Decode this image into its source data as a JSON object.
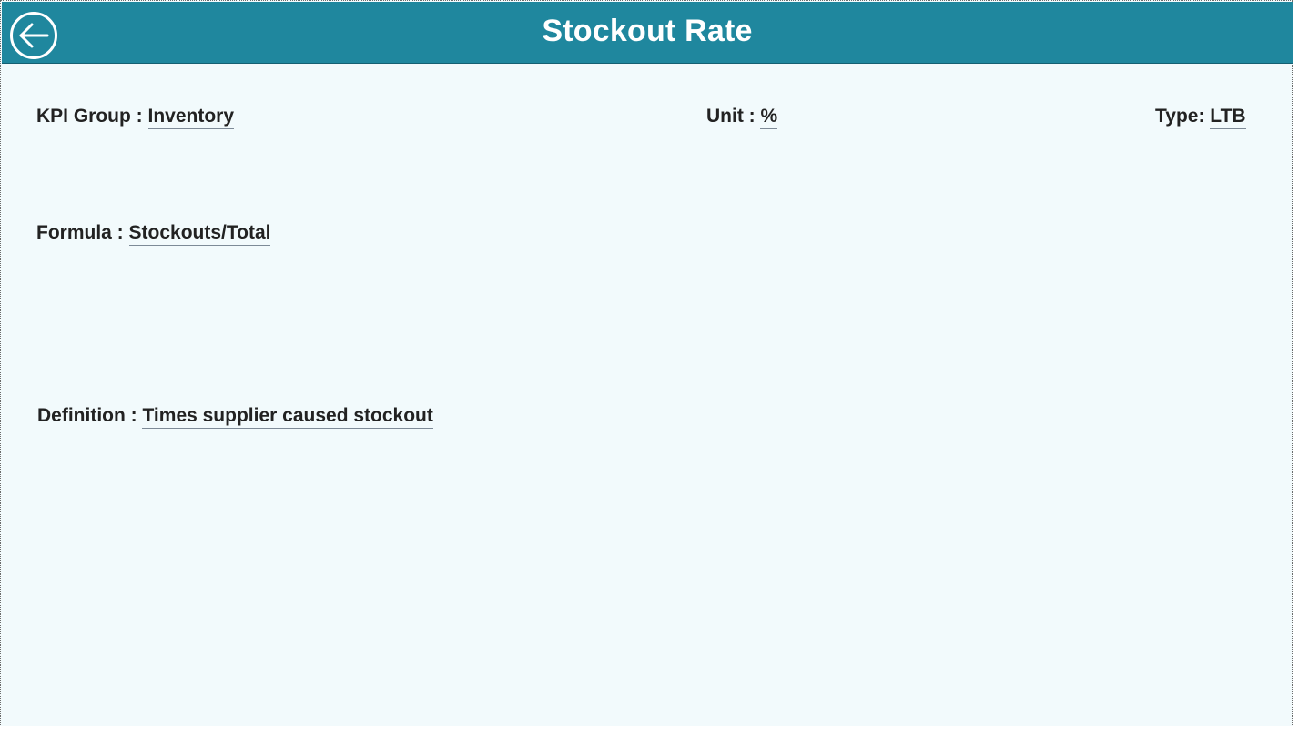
{
  "header": {
    "title": "Stockout Rate",
    "back_icon": "back-arrow-icon",
    "background_color": "#1f879e"
  },
  "fields": {
    "kpi_group": {
      "label": "KPI Group : ",
      "value": "Inventory"
    },
    "unit": {
      "label": "Unit : ",
      "value": "%"
    },
    "type": {
      "label": "Type: ",
      "value": "LTB"
    },
    "formula": {
      "label": "Formula : ",
      "value": "Stockouts/Total"
    },
    "definition": {
      "label": "Definition : ",
      "value": "Times supplier caused stockout"
    }
  },
  "colors": {
    "page_background": "#f2fafc",
    "text": "#222222"
  }
}
